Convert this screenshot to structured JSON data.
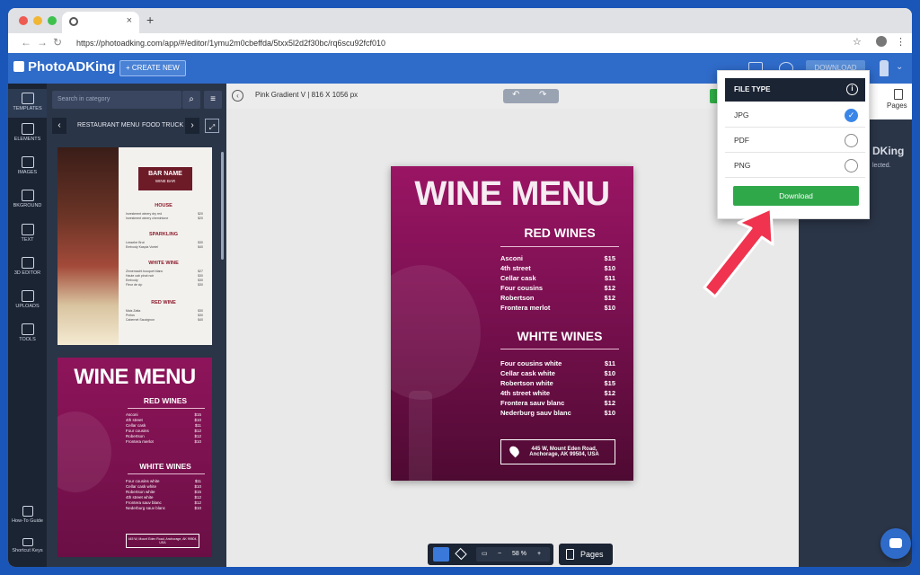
{
  "browser": {
    "tab_title": "",
    "new_tab": "+",
    "url": "https://photoadking.com/app/#/editor/1ymu2m0cbeffda/5txx5l2d2f30bc/rq6scu92fcf010"
  },
  "appbar": {
    "logo": "PhotoADKing",
    "create_new": "+ CREATE NEW",
    "download": "DOWNLOAD"
  },
  "sidebar": {
    "items": [
      {
        "label": "TEMPLATES",
        "icon": "templates-icon"
      },
      {
        "label": "ELEMENTS",
        "icon": "elements-icon"
      },
      {
        "label": "IMAGES",
        "icon": "images-icon"
      },
      {
        "label": "BKGROUND",
        "icon": "background-icon"
      },
      {
        "label": "TEXT",
        "icon": "text-icon"
      },
      {
        "label": "3D EDITOR",
        "icon": "3d-editor-icon"
      },
      {
        "label": "UPLOADS",
        "icon": "uploads-icon"
      },
      {
        "label": "TOOLS",
        "icon": "tools-icon"
      }
    ],
    "help": "How-To Guide",
    "shortcut": "Shortcut Keys"
  },
  "panel": {
    "search_placeholder": "Search in category",
    "categories": [
      "RESTAURANT MENU",
      "FOOD TRUCK"
    ],
    "thumb1": {
      "name": "BAR NAME",
      "sub": "WINE BAR",
      "sections": [
        "HOUSE",
        "SPARKLING",
        "WHITE WINE",
        "RED WINE"
      ],
      "lines": {
        "house": [
          [
            "Investment winery dry red",
            "$20"
          ],
          [
            "Investment winery chemintone",
            "$20"
          ]
        ],
        "sparkling": [
          [
            "Lessebe Brut",
            "$30"
          ],
          [
            "Emtvody Kaspia Vontel",
            "$40"
          ]
        ],
        "white": [
          [
            "Zinnemacht bouquet blanc",
            "$27"
          ],
          [
            "Haute cab pinot noir",
            "$30"
          ],
          [
            "Emtvody",
            "$30"
          ],
          [
            "Fleur de cip",
            "$30"
          ]
        ],
        "red": [
          [
            "Mais Zatta",
            "$30"
          ],
          [
            "Prelos",
            "$30"
          ],
          [
            "Cabernet Sauvignon",
            "$40"
          ]
        ]
      }
    },
    "thumb2": {
      "title": "WINE MENU",
      "red_head": "RED WINES",
      "red": [
        [
          "Asconi",
          "$15"
        ],
        [
          "4th street",
          "$10"
        ],
        [
          "Cellar cask",
          "$11"
        ],
        [
          "Four cousins",
          "$12"
        ],
        [
          "Robertson",
          "$12"
        ],
        [
          "Frontera merlot",
          "$10"
        ]
      ],
      "white_head": "WHITE WINES",
      "white": [
        [
          "Four cousins white",
          "$11"
        ],
        [
          "Cellar cask white",
          "$10"
        ],
        [
          "Robertson white",
          "$15"
        ],
        [
          "4th street white",
          "$12"
        ],
        [
          "Frontera sauv blanc",
          "$12"
        ],
        [
          "Nederburg sauv blanc",
          "$10"
        ]
      ],
      "address": "445 W, Mount Eden Road, Anchorage, AK 99504, USA"
    }
  },
  "canvas": {
    "doc_name": "Pink Gradient V",
    "doc_size": "| 816 X 1056 px",
    "zoom": "58 %",
    "pages": "Pages"
  },
  "poster": {
    "title": "WINE MENU",
    "red_head": "RED WINES",
    "red": [
      [
        "Asconi",
        "$15"
      ],
      [
        "4th street",
        "$10"
      ],
      [
        "Cellar cask",
        "$11"
      ],
      [
        "Four cousins",
        "$12"
      ],
      [
        "Robertson",
        "$12"
      ],
      [
        "Frontera merlot",
        "$10"
      ]
    ],
    "white_head": "WHITE WINES",
    "white": [
      [
        "Four cousins white",
        "$11"
      ],
      [
        "Cellar cask white",
        "$10"
      ],
      [
        "Robertson white",
        "$15"
      ],
      [
        "4th street white",
        "$12"
      ],
      [
        "Frontera sauv blanc",
        "$12"
      ],
      [
        "Nederburg sauv blanc",
        "$10"
      ]
    ],
    "address_line1": "445 W, Mount Eden Road,",
    "address_line2": "Anchorage, AK 99504, USA"
  },
  "right_panel": {
    "pages": "Pages",
    "logo": "DKing",
    "selected_text": "lected."
  },
  "popup": {
    "title": "FILE TYPE",
    "options": [
      {
        "label": "JPG",
        "selected": true
      },
      {
        "label": "PDF",
        "selected": false
      },
      {
        "label": "PNG",
        "selected": false
      }
    ],
    "download": "Download"
  },
  "colors": {
    "accent": "#2f6bc9",
    "download_green": "#2fa84a",
    "poster": "#7a1050",
    "arrow": "#f0334e"
  }
}
